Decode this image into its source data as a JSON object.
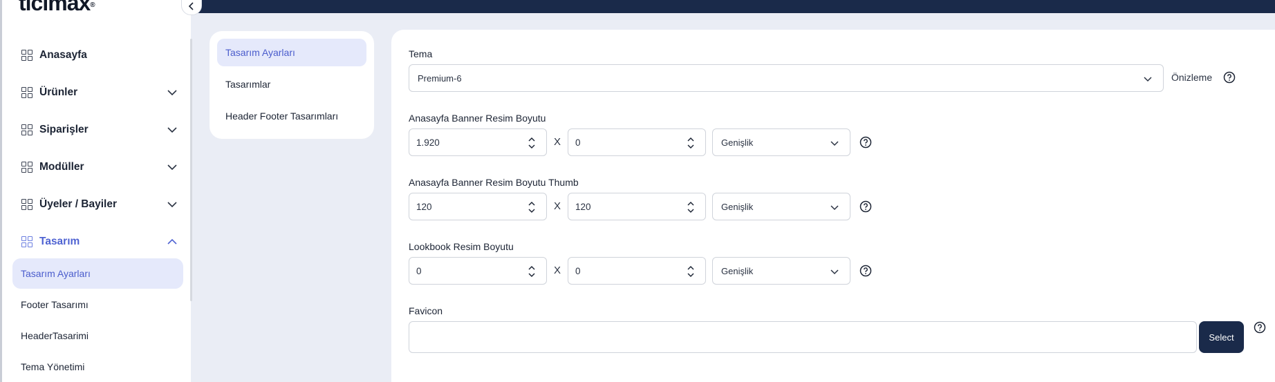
{
  "brand": {
    "logo_text": "ticimax",
    "logo_mark": "®"
  },
  "colors": {
    "navy": "#1a2a4a",
    "accent": "#4f63d2",
    "active_bg": "#e5e9fb"
  },
  "sidebar": {
    "items": [
      {
        "label": "Anasayfa",
        "icon": "grid-icon",
        "expandable": false
      },
      {
        "label": "Ürünler",
        "icon": "grid-icon",
        "expandable": true
      },
      {
        "label": "Siparişler",
        "icon": "grid-icon",
        "expandable": true
      },
      {
        "label": "Modüller",
        "icon": "grid-icon",
        "expandable": true
      },
      {
        "label": "Üyeler / Bayiler",
        "icon": "grid-icon",
        "expandable": true
      },
      {
        "label": "Tasarım",
        "icon": "grid-icon",
        "expandable": true,
        "expanded": true,
        "active": true
      }
    ],
    "sub_items": [
      {
        "label": "Tasarım Ayarları",
        "active": true
      },
      {
        "label": "Footer Tasarımı"
      },
      {
        "label": "HeaderTasarimi"
      },
      {
        "label": "Tema Yönetimi"
      }
    ]
  },
  "section_nav": {
    "items": [
      {
        "label": "Tasarım Ayarları",
        "active": true
      },
      {
        "label": "Tasarımlar"
      },
      {
        "label": "Header Footer Tasarımları"
      }
    ]
  },
  "form": {
    "theme": {
      "label": "Tema",
      "value": "Premium-6",
      "preview_label": "Önizleme"
    },
    "banner_size": {
      "label": "Anasayfa Banner Resim Boyutu",
      "width": "1.920",
      "height": "0",
      "mode": "Genişlik",
      "separator": "X"
    },
    "banner_thumb_size": {
      "label": "Anasayfa Banner Resim Boyutu Thumb",
      "width": "120",
      "height": "120",
      "mode": "Genişlik",
      "separator": "X"
    },
    "lookbook_size": {
      "label": "Lookbook Resim Boyutu",
      "width": "0",
      "height": "0",
      "mode": "Genişlik",
      "separator": "X"
    },
    "favicon": {
      "label": "Favicon",
      "value": "",
      "button_label": "Select"
    }
  }
}
